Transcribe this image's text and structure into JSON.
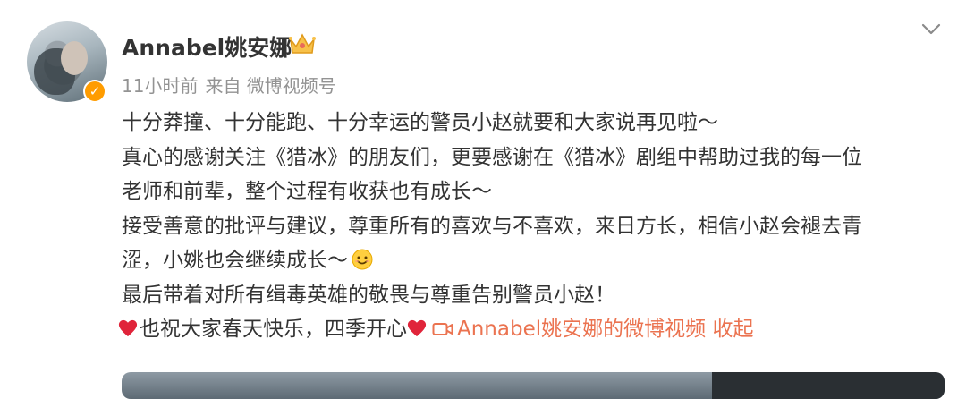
{
  "post": {
    "author": "Annabel姚安娜",
    "time": "11小时前",
    "source": "来自 微博视频号",
    "lines": [
      "十分莽撞、十分能跑、十分幸运的警员小赵就要和大家说再见啦～",
      "真心的感谢关注《猎冰》的朋友们，更要感谢在《猎冰》剧组中帮助过我的每一位",
      "老师和前辈，整个过程有收获也有成长～",
      "接受善意的批评与建议，尊重所有的喜欢与不喜欢，来日方长，相信小赵会褪去青",
      "涩，小姚也会继续成长～",
      "最后带着对所有缉毒英雄的敬畏与尊重告别警员小赵！"
    ],
    "last_line_text": "也祝大家春天快乐，四季开心",
    "video_link": "Annabel姚安娜的微博视频",
    "collapse": "收起"
  },
  "colors": {
    "link": "#eb7350",
    "meta": "#939393",
    "verified_badge": "#ff9c00",
    "heart": "#e0243a"
  },
  "icons": {
    "verified": "verified-badge-icon",
    "crown": "crown-member-icon",
    "menu": "chevron-down-icon",
    "heart": "red-heart-icon",
    "video": "video-camera-icon",
    "smile": "smile-emoji-icon"
  }
}
